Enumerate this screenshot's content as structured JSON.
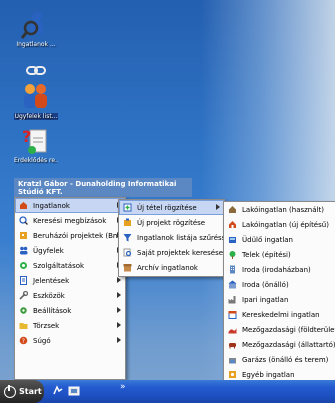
{
  "desktop": {
    "icons": [
      {
        "label": "Ingatlanok ...",
        "icon": "search-person-icon"
      },
      {
        "label": "Ügyfelek list...",
        "icon": "users-icon"
      },
      {
        "label": "Érdeklődés re...",
        "icon": "question-clipboard-icon"
      }
    ]
  },
  "menu_header": {
    "text": "Kratzl Gábor - Dunaholding Informatikai Stúdió KFT."
  },
  "main_menu": {
    "items": [
      {
        "label": "Ingatlanok",
        "icon": "house-icon",
        "submenu": true
      },
      {
        "label": "Keresési megbízások",
        "icon": "search-icon",
        "submenu": true
      },
      {
        "label": "Beruházói projektek (BmBy)",
        "icon": "building-icon",
        "submenu": true
      },
      {
        "label": "Ügyfelek",
        "icon": "users-icon",
        "submenu": true
      },
      {
        "label": "Szolgáltatások",
        "icon": "services-icon",
        "submenu": true
      },
      {
        "label": "Jelentések",
        "icon": "report-icon",
        "submenu": true
      },
      {
        "label": "Eszközök",
        "icon": "tools-icon",
        "submenu": true
      },
      {
        "label": "Beállítások",
        "icon": "settings-icon",
        "submenu": true
      },
      {
        "label": "Törzsek",
        "icon": "folder-icon",
        "submenu": true
      },
      {
        "label": "Súgó",
        "icon": "help-icon",
        "submenu": true
      }
    ]
  },
  "submenu_ingatlanok": {
    "items": [
      {
        "label": "Új tétel rögzítése",
        "icon": "new-item-icon",
        "submenu": true
      },
      {
        "label": "Új projekt rögzítése",
        "icon": "new-project-icon",
        "submenu": false
      },
      {
        "label": "Ingatlanok listája szűréssel",
        "icon": "filter-list-icon",
        "submenu": false
      },
      {
        "label": "Saját projektek keresése",
        "icon": "search-projects-icon",
        "submenu": false
      },
      {
        "label": "Archív ingatlanok",
        "icon": "archive-icon",
        "submenu": false
      }
    ]
  },
  "submenu_uj_tetel": {
    "items": [
      {
        "label": "Lakóingatlan (használt)",
        "icon": "house-used-icon"
      },
      {
        "label": "Lakóingatlan (új építésű)",
        "icon": "house-new-icon"
      },
      {
        "label": "Üdülő ingatlan",
        "icon": "holiday-home-icon"
      },
      {
        "label": "Telek (építési)",
        "icon": "land-plot-icon"
      },
      {
        "label": "Iroda (irodaházban)",
        "icon": "office-building-icon"
      },
      {
        "label": "Iroda (önálló)",
        "icon": "office-standalone-icon"
      },
      {
        "label": "Ipari ingatlan",
        "icon": "factory-icon"
      },
      {
        "label": "Kereskedelmi ingatlan",
        "icon": "shop-icon"
      },
      {
        "label": "Mezőgazdasági (földterület)",
        "icon": "farmland-icon"
      },
      {
        "label": "Mezőgazdasági (állattartó)",
        "icon": "livestock-icon"
      },
      {
        "label": "Garázs (önálló és terem)",
        "icon": "garage-icon"
      },
      {
        "label": "Egyéb ingatlan",
        "icon": "other-property-icon"
      }
    ]
  },
  "taskbar": {
    "start_label": "Start",
    "separator": "»"
  }
}
